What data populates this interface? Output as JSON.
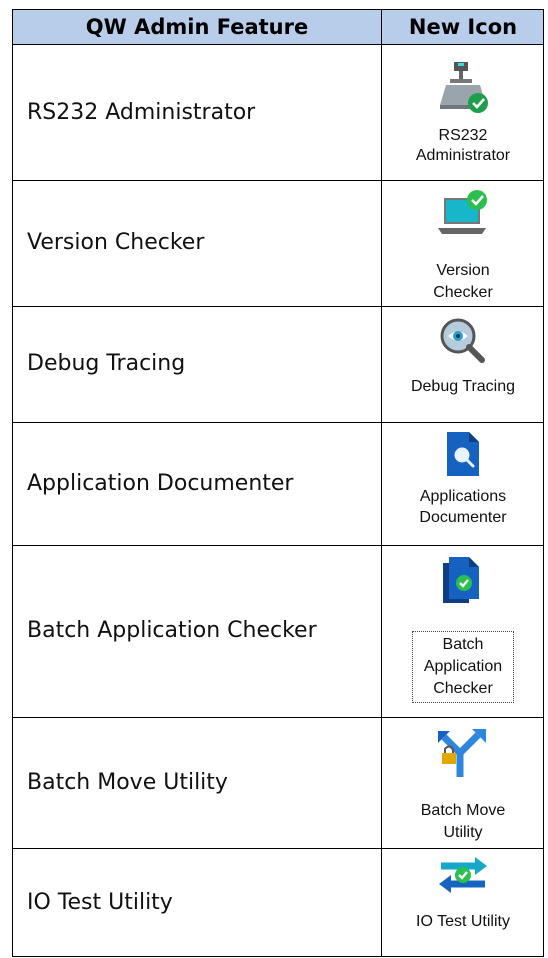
{
  "header": {
    "feature_col": "QW Admin Feature",
    "icon_col": "New Icon"
  },
  "rows": [
    {
      "feature": "RS232 Administrator",
      "icon": "scale-check-icon",
      "caption": [
        "RS232",
        "Administrator"
      ]
    },
    {
      "feature": "Version Checker",
      "icon": "laptop-check-icon",
      "caption": [
        "Version",
        "Checker"
      ]
    },
    {
      "feature": "Debug Tracing",
      "icon": "magnifier-eye-icon",
      "caption": [
        "Debug Tracing"
      ]
    },
    {
      "feature": "Application Documenter",
      "icon": "document-search-icon",
      "caption": [
        "Applications",
        "Documenter"
      ]
    },
    {
      "feature": "Batch Application Checker",
      "icon": "documents-check-icon",
      "caption": [
        "Batch",
        "Application",
        "Checker"
      ]
    },
    {
      "feature": "Batch Move Utility",
      "icon": "split-arrow-lock-icon",
      "caption": [
        "Batch Move",
        "Utility"
      ]
    },
    {
      "feature": "IO Test Utility",
      "icon": "swap-arrows-check-icon",
      "caption": [
        "IO Test Utility"
      ]
    }
  ],
  "colors": {
    "header_bg": "#b8cde9",
    "check_green": "#1e9e4a",
    "accent_blue": "#1565c0",
    "cyan": "#17a7c9"
  }
}
